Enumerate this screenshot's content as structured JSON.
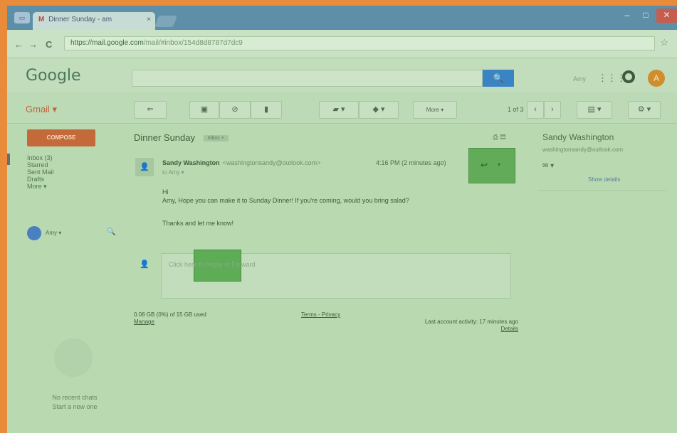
{
  "browser": {
    "tab_title": "Dinner Sunday - am",
    "tab_icon": "M",
    "tab_close": "×",
    "url_host": "https://mail.google.com",
    "url_path": "/mail/#inbox/154d8d8787d7dc9",
    "window_controls": {
      "minimize": "–",
      "maximize": "□",
      "close": "✕"
    },
    "nav": {
      "back": "←",
      "forward": "→",
      "reload": "C"
    },
    "star": "☆"
  },
  "header": {
    "logo": "Google",
    "search_button": "🔍",
    "user_name": "Amy",
    "apps_icon": "⋮⋮⋮",
    "avatar_initial": "A"
  },
  "toolbar": {
    "gmail_label": "Gmail ▾",
    "back_btn": "⇐",
    "archive_btn": "▣",
    "spam_btn": "⊘",
    "delete_btn": "▮",
    "move_btn": "▰ ▾",
    "labels_btn": "◆ ▾",
    "more_btn": "More ▾",
    "pager": "1 of 3",
    "prev": "‹",
    "next": "›",
    "density_btn": "▤ ▾",
    "settings_btn": "⚙ ▾"
  },
  "sidebar": {
    "compose_label": "COMPOSE",
    "items": [
      {
        "label": "Inbox (3)"
      },
      {
        "label": "Starred"
      },
      {
        "label": "Sent Mail"
      },
      {
        "label": "Drafts"
      },
      {
        "label": "More ▾"
      }
    ],
    "chat_user": "Amy ▾",
    "chat_search": "🔍",
    "no_chats": "No recent chats",
    "start_chat": "Start a new one"
  },
  "conversation": {
    "subject": "Dinner Sunday",
    "label_badge": "Inbox ×",
    "subject_icons": "⎙ ▤",
    "sender_name": "Sandy Washington",
    "sender_email": "<washingtonsandy@outlook.com>",
    "to_me": "to Amy ▾",
    "time": "4:16 PM (2 minutes ago)",
    "reply_icon": "↩",
    "more_icon": "▾",
    "greeting": "Hi",
    "body_line": "Amy, Hope you can make it to Sunday Dinner!  If you're coming, would you bring salad?",
    "closing": "Thanks and let me know!",
    "reply_placeholder": "Click here to Reply or Forward"
  },
  "footer": {
    "storage": "0.08 GB (0%) of 15 GB used",
    "manage": "Manage",
    "terms": "Terms - Privacy",
    "activity": "Last account activity: 17 minutes ago",
    "details": "Details"
  },
  "contact": {
    "name": "Sandy Washington",
    "email": "washingtonsandy@outlook.com",
    "mail_icon": "✉ ▾",
    "show_details": "Show details"
  }
}
